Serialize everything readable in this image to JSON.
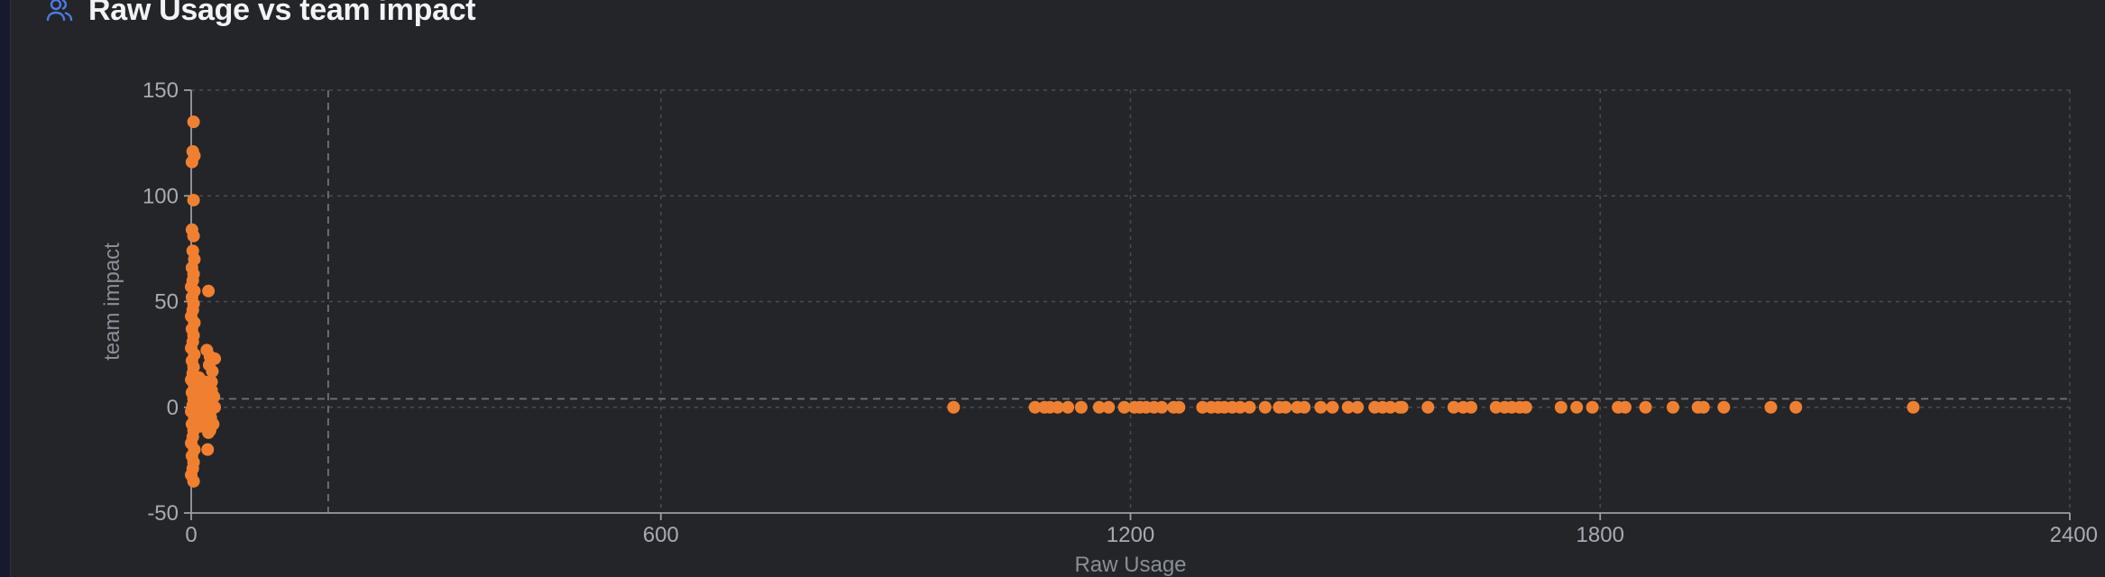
{
  "header": {
    "title": "Raw Usage vs team impact",
    "icon": "users-icon"
  },
  "colors": {
    "accent": "#4d7ce0",
    "point": "#f08030",
    "grid": "#4a4d53",
    "axis": "#9a9ea6"
  },
  "chart_data": {
    "type": "scatter",
    "title": "Raw Usage vs team impact",
    "xlabel": "Raw Usage",
    "ylabel": "team impact",
    "xlim": [
      0,
      2400
    ],
    "ylim": [
      -50,
      150
    ],
    "xticks": [
      0,
      600,
      1200,
      1800,
      2400
    ],
    "yticks": [
      -50,
      0,
      50,
      100,
      150
    ],
    "x_reference_line": 175,
    "y_reference_line": 4,
    "grid": true,
    "legend": "none",
    "series": [
      {
        "points": [
          [
            3,
            135
          ],
          [
            2,
            121
          ],
          [
            4,
            119
          ],
          [
            1,
            116
          ],
          [
            3,
            98
          ],
          [
            1,
            84
          ],
          [
            3,
            81
          ],
          [
            2,
            74
          ],
          [
            4,
            70
          ],
          [
            1,
            66
          ],
          [
            3,
            63
          ],
          [
            2,
            60
          ],
          [
            0,
            57
          ],
          [
            4,
            55
          ],
          [
            1,
            52
          ],
          [
            3,
            49
          ],
          [
            2,
            46
          ],
          [
            0,
            43
          ],
          [
            4,
            40
          ],
          [
            1,
            37
          ],
          [
            3,
            34
          ],
          [
            2,
            31
          ],
          [
            0,
            28
          ],
          [
            4,
            25
          ],
          [
            1,
            22
          ],
          [
            3,
            19
          ],
          [
            2,
            16
          ],
          [
            0,
            13
          ],
          [
            4,
            10
          ],
          [
            1,
            7
          ],
          [
            3,
            4
          ],
          [
            2,
            1
          ],
          [
            0,
            -2
          ],
          [
            4,
            -5
          ],
          [
            1,
            -8
          ],
          [
            3,
            -11
          ],
          [
            2,
            -14
          ],
          [
            0,
            -17
          ],
          [
            4,
            -20
          ],
          [
            1,
            -23
          ],
          [
            3,
            -26
          ],
          [
            2,
            -29
          ],
          [
            0,
            -32
          ],
          [
            3,
            -35
          ],
          [
            6,
            -3
          ],
          [
            7,
            5
          ],
          [
            6,
            10
          ],
          [
            8,
            0
          ],
          [
            9,
            -6
          ],
          [
            10,
            14
          ],
          [
            11,
            2
          ],
          [
            12,
            -9
          ],
          [
            13,
            8
          ],
          [
            14,
            -2
          ],
          [
            15,
            -4
          ],
          [
            16,
            4
          ],
          [
            17,
            -1
          ],
          [
            18,
            12
          ],
          [
            19,
            -7
          ],
          [
            20,
            3
          ],
          [
            21,
            6
          ],
          [
            22,
            -12
          ],
          [
            23,
            9
          ],
          [
            24,
            -3
          ],
          [
            25,
            1
          ],
          [
            22,
            55
          ],
          [
            21,
            -20
          ],
          [
            20,
            27
          ],
          [
            23,
            20
          ],
          [
            24,
            -11
          ],
          [
            26,
            12
          ],
          [
            27,
            17
          ],
          [
            28,
            -8
          ],
          [
            29,
            5
          ],
          [
            30,
            0
          ],
          [
            24,
            24
          ],
          [
            30,
            23
          ],
          [
            25,
            -5
          ],
          [
            26,
            8
          ],
          [
            22,
            -1
          ],
          [
            974,
            0
          ],
          [
            1078,
            0
          ],
          [
            1090,
            0
          ],
          [
            1097,
            0
          ],
          [
            1107,
            0
          ],
          [
            1120,
            0
          ],
          [
            1137,
            0
          ],
          [
            1160,
            0
          ],
          [
            1172,
            0
          ],
          [
            1192,
            0
          ],
          [
            1205,
            0
          ],
          [
            1212,
            0
          ],
          [
            1220,
            0
          ],
          [
            1230,
            0
          ],
          [
            1240,
            0
          ],
          [
            1255,
            0
          ],
          [
            1262,
            0
          ],
          [
            1292,
            0
          ],
          [
            1303,
            0
          ],
          [
            1312,
            0
          ],
          [
            1320,
            0
          ],
          [
            1330,
            0
          ],
          [
            1340,
            0
          ],
          [
            1352,
            0
          ],
          [
            1372,
            0
          ],
          [
            1390,
            0
          ],
          [
            1398,
            0
          ],
          [
            1413,
            0
          ],
          [
            1422,
            0
          ],
          [
            1443,
            0
          ],
          [
            1458,
            0
          ],
          [
            1478,
            0
          ],
          [
            1490,
            0
          ],
          [
            1512,
            0
          ],
          [
            1522,
            0
          ],
          [
            1532,
            0
          ],
          [
            1544,
            0
          ],
          [
            1547,
            0
          ],
          [
            1580,
            0
          ],
          [
            1613,
            0
          ],
          [
            1625,
            0
          ],
          [
            1635,
            0
          ],
          [
            1667,
            0
          ],
          [
            1678,
            0
          ],
          [
            1687,
            0
          ],
          [
            1697,
            0
          ],
          [
            1705,
            0
          ],
          [
            1750,
            0
          ],
          [
            1770,
            0
          ],
          [
            1790,
            0
          ],
          [
            1823,
            0
          ],
          [
            1832,
            0
          ],
          [
            1858,
            0
          ],
          [
            1893,
            0
          ],
          [
            1925,
            0
          ],
          [
            1932,
            0
          ],
          [
            1958,
            0
          ],
          [
            2018,
            0
          ],
          [
            2050,
            0
          ],
          [
            2200,
            0
          ]
        ]
      }
    ]
  }
}
